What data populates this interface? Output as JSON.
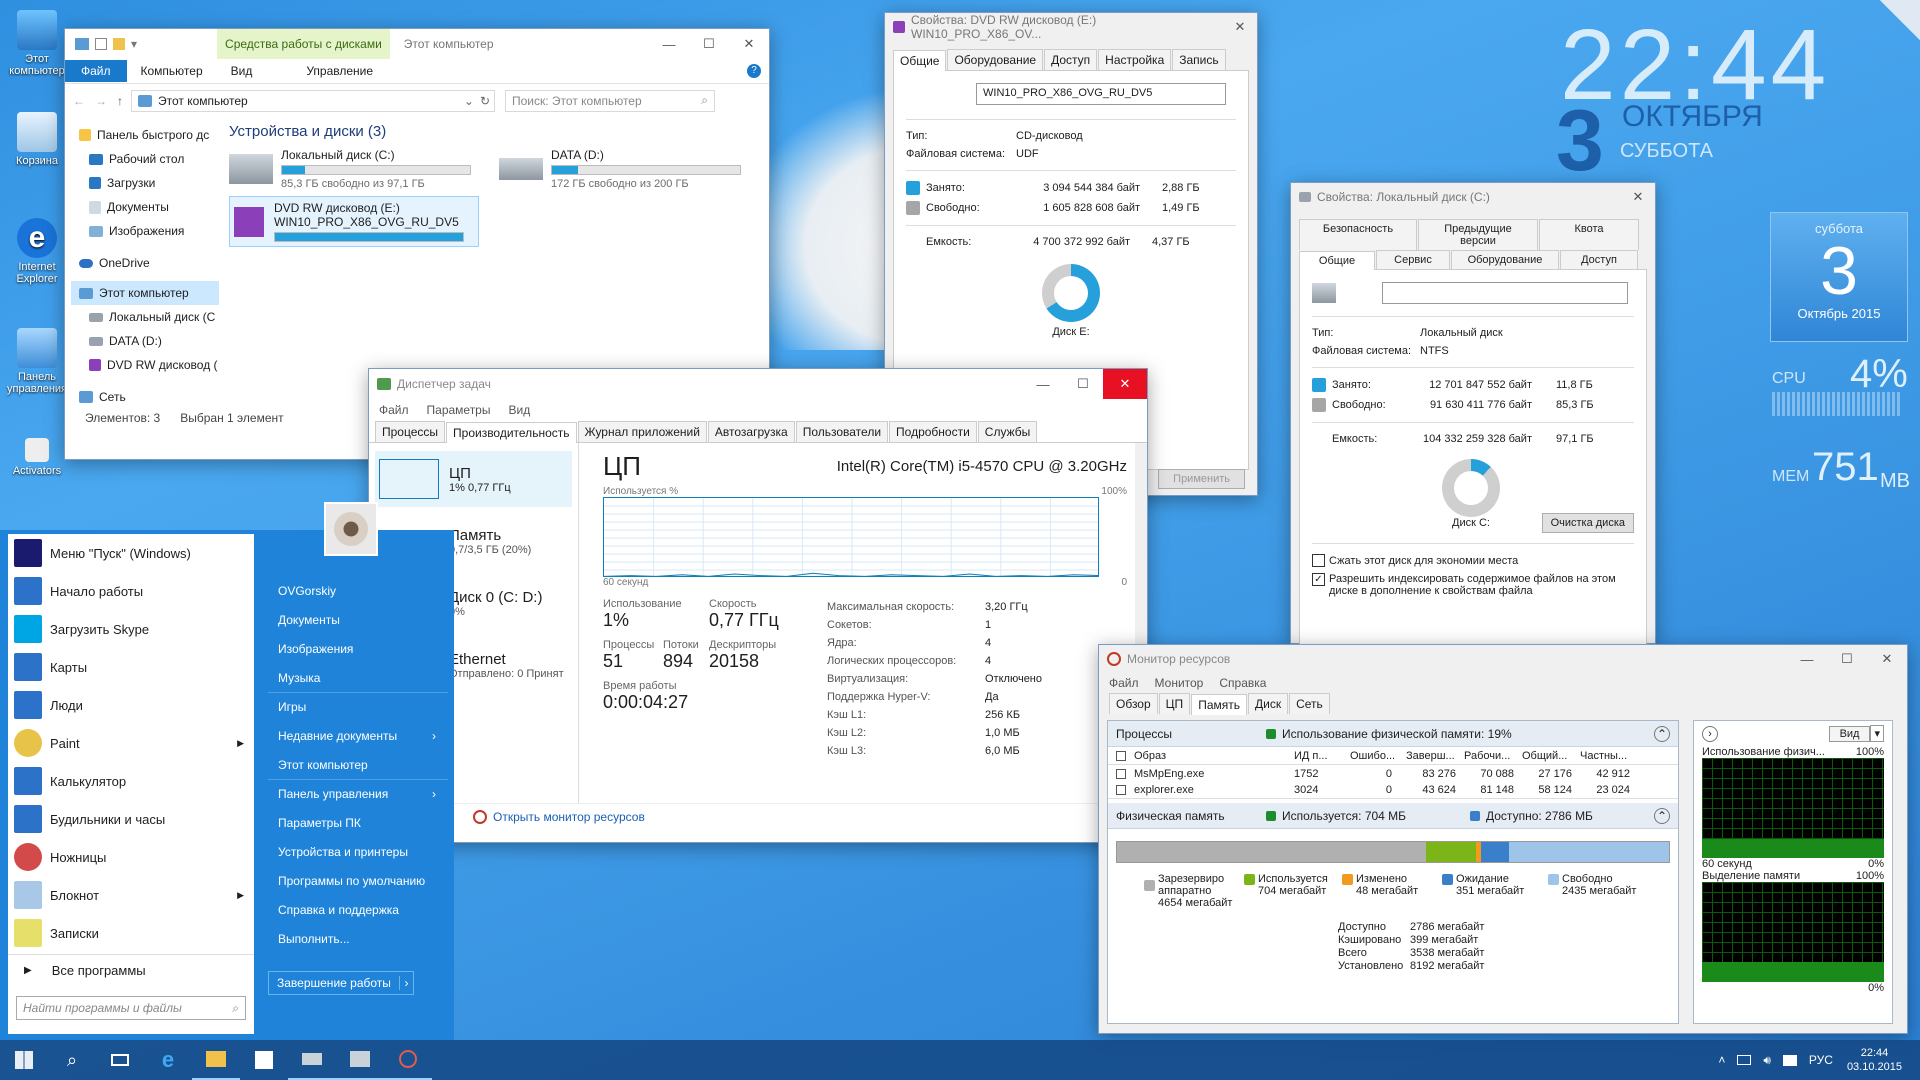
{
  "desktop": {
    "icons": [
      "Этот компьютер",
      "Корзина",
      "Internet Explorer",
      "Панель управления",
      "Activators"
    ]
  },
  "clock": {
    "time": "22:44",
    "day": "3",
    "month": "ОКТЯБРЯ",
    "weekday": "СУББОТА"
  },
  "gadget": {
    "weekday": "суббота",
    "day": "3",
    "month_year": "Октябрь 2015",
    "cpu_label": "CPU",
    "cpu_value": "4%",
    "mem_label": "MEM",
    "mem_value": "751",
    "mem_unit": "MB"
  },
  "explorer": {
    "ribbon_context": "Средства работы с дисками",
    "title": "Этот компьютер",
    "menu": [
      "Файл",
      "Компьютер",
      "Вид",
      "Управление"
    ],
    "address": "Этот компьютер",
    "search_placeholder": "Поиск: Этот компьютер",
    "nav": [
      "Панель быстрого дс",
      "Рабочий стол",
      "Загрузки",
      "Документы",
      "Изображения",
      "OneDrive",
      "Этот компьютер",
      "Локальный диск (С",
      "DATA (D:)",
      "DVD RW дисковод (",
      "Сеть"
    ],
    "section": "Устройства и диски (3)",
    "drives": [
      {
        "name": "Локальный диск (C:)",
        "info": "85,3 ГБ свободно из 97,1 ГБ",
        "fill": 0.12
      },
      {
        "name": "DATA (D:)",
        "info": "172 ГБ свободно из 200 ГБ",
        "fill": 0.14
      }
    ],
    "dvd": {
      "name": "DVD RW дисковод (E:)",
      "label": "WIN10_PRO_X86_OVG_RU_DV5",
      "fill": 1.0
    },
    "status": [
      "Элементов: 3",
      "Выбран 1 элемент"
    ]
  },
  "dvdprops": {
    "title": "Свойства: DVD RW дисковод (E:) WIN10_PRO_X86_OV...",
    "tabs": [
      "Общие",
      "Оборудование",
      "Доступ",
      "Настройка",
      "Запись"
    ],
    "label": "WIN10_PRO_X86_OVG_RU_DV5",
    "type_k": "Тип:",
    "type_v": "CD-дисковод",
    "fs_k": "Файловая система:",
    "fs_v": "UDF",
    "used_k": "Занято:",
    "used_b": "3 094 544 384 байт",
    "used_g": "2,88 ГБ",
    "free_k": "Свободно:",
    "free_b": "1 605 828 608 байт",
    "free_g": "1,49 ГБ",
    "cap_k": "Емкость:",
    "cap_b": "4 700 372 992 байт",
    "cap_g": "4,37 ГБ",
    "disk": "Диск E:",
    "apply": "Применить"
  },
  "cprops": {
    "title": "Свойства: Локальный диск (C:)",
    "tabs1": [
      "Безопасность",
      "Предыдущие версии",
      "Квота"
    ],
    "tabs2": [
      "Общие",
      "Сервис",
      "Оборудование",
      "Доступ"
    ],
    "type_k": "Тип:",
    "type_v": "Локальный диск",
    "fs_k": "Файловая система:",
    "fs_v": "NTFS",
    "used_k": "Занято:",
    "used_b": "12 701 847 552 байт",
    "used_g": "11,8 ГБ",
    "free_k": "Свободно:",
    "free_b": "91 630 411 776 байт",
    "free_g": "85,3 ГБ",
    "cap_k": "Емкость:",
    "cap_b": "104 332 259 328 байт",
    "cap_g": "97,1 ГБ",
    "disk": "Диск C:",
    "cleanup": "Очистка диска",
    "chk1": "Сжать этот диск для экономии места",
    "chk2": "Разрешить индексировать содержимое файлов на этом диске в дополнение к свойствам файла"
  },
  "taskmgr": {
    "title": "Диспетчер задач",
    "menu": [
      "Файл",
      "Параметры",
      "Вид"
    ],
    "tabs": [
      "Процессы",
      "Производительность",
      "Журнал приложений",
      "Автозагрузка",
      "Пользователи",
      "Подробности",
      "Службы"
    ],
    "side": [
      {
        "name": "ЦП",
        "sub": "1% 0,77 ГГц"
      },
      {
        "name": "Память",
        "sub": "0,7/3,5 ГБ (20%)"
      },
      {
        "name": "Диск 0 (C: D:)",
        "sub": "0%"
      },
      {
        "name": "Ethernet",
        "sub": "Отправлено: 0 Принят"
      }
    ],
    "head": "ЦП",
    "cpu": "Intel(R) Core(TM) i5-4570 CPU @ 3.20GHz",
    "usage_lbl": "Используется %",
    "pct": "100%",
    "secs": "60 секунд",
    "zero": "0",
    "s1k": "Использование",
    "s1v": "1%",
    "s2k": "Скорость",
    "s2v": "0,77 ГГц",
    "s3k": "Процессы",
    "s3v": "51",
    "s4k": "Потоки",
    "s4v": "894",
    "s5k": "Дескрипторы",
    "s5v": "20158",
    "s6k": "Время работы",
    "s6v": "0:00:04:27",
    "specs": [
      [
        "Максимальная скорость:",
        "3,20 ГГц"
      ],
      [
        "Сокетов:",
        "1"
      ],
      [
        "Ядра:",
        "4"
      ],
      [
        "Логических процессоров:",
        "4"
      ],
      [
        "Виртуализация:",
        "Отключено"
      ],
      [
        "Поддержка Hyper-V:",
        "Да"
      ],
      [
        "Кэш L1:",
        "256 КБ"
      ],
      [
        "Кэш L2:",
        "1,0 МБ"
      ],
      [
        "Кэш L3:",
        "6,0 МБ"
      ]
    ],
    "link": "Открыть монитор ресурсов",
    "load": [
      0.02,
      0.03,
      0.02,
      0.04,
      0.02,
      0.05,
      0.03,
      0.02,
      0.06,
      0.03,
      0.02,
      0.04,
      0.03,
      0.02,
      0.05,
      0.02,
      0.03,
      0.02,
      0.04,
      0.03
    ]
  },
  "resmon": {
    "title": "Монитор ресурсов",
    "menu": [
      "Файл",
      "Монитор",
      "Справка"
    ],
    "tabs": [
      "Обзор",
      "ЦП",
      "Память",
      "Диск",
      "Сеть"
    ],
    "proc_h": "Процессы",
    "proc_use": "Использование физической памяти: 19%",
    "cols": [
      "Образ",
      "ИД п...",
      "Ошибо...",
      "Заверш...",
      "Рабочи...",
      "Общий...",
      "Частны..."
    ],
    "rows": [
      [
        "MsMpEng.exe",
        "1752",
        "0",
        "83 276",
        "70 088",
        "27 176",
        "42 912"
      ],
      [
        "explorer.exe",
        "3024",
        "0",
        "43 624",
        "81 148",
        "58 124",
        "23 024"
      ]
    ],
    "phys_h": "Физическая память",
    "phys_used": "Используется: 704 МБ",
    "phys_avail": "Доступно: 2786 МБ",
    "legend": [
      [
        "Зарезервиро аппаратно",
        "4654 мегабайт",
        "#b0b0b0"
      ],
      [
        "Используется",
        "704 мегабайт",
        "#7cb518"
      ],
      [
        "Изменено",
        "48 мегабайт",
        "#f29a1c"
      ],
      [
        "Ожидание",
        "351 мегабайт",
        "#3a7fc9"
      ],
      [
        "Свободно",
        "2435 мегабайт",
        "#9fc4ea"
      ]
    ],
    "totals": [
      [
        "Доступно",
        "2786 мегабайт"
      ],
      [
        "Кэшировано",
        "399 мегабайт"
      ],
      [
        "Всего",
        "3538 мегабайт"
      ],
      [
        "Установлено",
        "8192 мегабайт"
      ]
    ],
    "right_view": "Вид",
    "g1": "Использование физич...",
    "g1p": "100%",
    "g1s": "60 секунд",
    "g1z": "0%",
    "g2": "Выделение памяти",
    "g2p": "100%",
    "g2z": "0%"
  },
  "startmenu": {
    "left": [
      "Меню \"Пуск\" (Windows)",
      "Начало работы",
      "Загрузить Skype",
      "Карты",
      "Люди",
      "Paint",
      "Калькулятор",
      "Будильники и часы",
      "Ножницы",
      "Блокнот",
      "Записки"
    ],
    "all": "Все программы",
    "search_placeholder": "Найти программы и файлы",
    "right": [
      "OVGorskiy",
      "Документы",
      "Изображения",
      "Музыка",
      "Игры",
      "Недавние документы",
      "Этот компьютер",
      "Панель управления",
      "Параметры ПК",
      "Устройства и принтеры",
      "Программы по умолчанию",
      "Справка и поддержка",
      "Выполнить..."
    ],
    "shutdown": "Завершение работы"
  },
  "taskbar": {
    "lang": "РУС",
    "time": "22:44",
    "date": "03.10.2015"
  }
}
